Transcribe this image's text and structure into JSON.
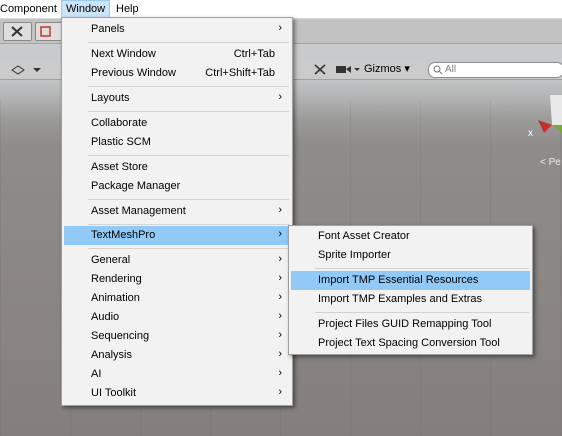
{
  "menubar": {
    "items": [
      {
        "label": "Component"
      },
      {
        "label": "Window"
      },
      {
        "label": "Help"
      }
    ]
  },
  "scene_toolbar": {
    "gizmos_label": "Gizmos",
    "search_placeholder": "All"
  },
  "scene_view": {
    "axis_label": "x",
    "projection_label": "< Pe"
  },
  "window_menu": {
    "items": [
      {
        "label": "Panels",
        "submenu": true
      },
      {
        "label": "Next Window",
        "shortcut": "Ctrl+Tab"
      },
      {
        "label": "Previous Window",
        "shortcut": "Ctrl+Shift+Tab"
      },
      {
        "label": "Layouts",
        "submenu": true
      },
      {
        "label": "Collaborate"
      },
      {
        "label": "Plastic SCM"
      },
      {
        "label": "Asset Store"
      },
      {
        "label": "Package Manager"
      },
      {
        "label": "Asset Management",
        "submenu": true
      },
      {
        "label": "TextMeshPro",
        "submenu": true,
        "highlighted": true
      },
      {
        "label": "General",
        "submenu": true
      },
      {
        "label": "Rendering",
        "submenu": true
      },
      {
        "label": "Animation",
        "submenu": true
      },
      {
        "label": "Audio",
        "submenu": true
      },
      {
        "label": "Sequencing",
        "submenu": true
      },
      {
        "label": "Analysis",
        "submenu": true
      },
      {
        "label": "AI",
        "submenu": true
      },
      {
        "label": "UI Toolkit",
        "submenu": true
      }
    ]
  },
  "textmeshpro_menu": {
    "items": [
      {
        "label": "Font Asset Creator"
      },
      {
        "label": "Sprite Importer"
      },
      {
        "label": "Import TMP Essential Resources",
        "highlighted": true
      },
      {
        "label": "Import TMP Examples and Extras"
      },
      {
        "label": "Project Files GUID Remapping Tool"
      },
      {
        "label": "Project Text Spacing Conversion Tool"
      }
    ]
  },
  "glyphs": {
    "submenu_arrow": "›",
    "dropdown": "▾"
  },
  "colors": {
    "highlight": "#91c9f7",
    "menu_bg": "#f2f2f2",
    "active_menubar": "#cce4f7"
  }
}
